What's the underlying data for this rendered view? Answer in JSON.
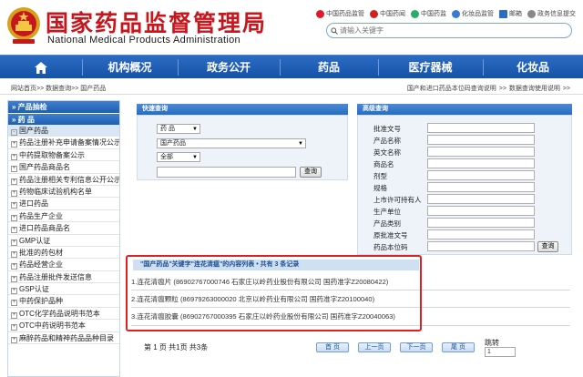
{
  "header": {
    "title": "国家药品监督管理局",
    "subtitle": "National Medical Products Administration",
    "top_links": [
      {
        "label": "中国药品监管",
        "icon": "weibo-icon",
        "color": "#e6162d"
      },
      {
        "label": "中国药闻",
        "icon": "news-icon",
        "color": "#d02020"
      },
      {
        "label": "中国药监",
        "icon": "wechat-icon",
        "color": "#2aae67"
      },
      {
        "label": "化妆品监管",
        "icon": "cosmetics-icon",
        "color": "#3a7bd5"
      },
      {
        "label": "邮箱",
        "icon": "mail-icon",
        "color": "#2b6cc4"
      },
      {
        "label": "政务信息提交",
        "icon": "submit-icon",
        "color": "#888888"
      }
    ],
    "search_placeholder": "请输入关键字"
  },
  "nav": {
    "items": [
      "机构概况",
      "政务公开",
      "药品",
      "医疗器械",
      "化妆品"
    ],
    "home_icon": "home-icon"
  },
  "breadcrumb": {
    "path": "网站首页>> 数据查询>> 国产药品",
    "right_links": "国产和进口药品本位码查询说明 >>    数据查询使用说明 >>"
  },
  "sidebar": {
    "section1": "» 产品抽检",
    "section2": "» 药    品",
    "items": [
      "国产药品",
      "药品注册补充申请备案情况公示",
      "中药提取物备案公示",
      "国产药品商品名",
      "药品注册相关专利信息公开公示",
      "药物临床试验机构名单",
      "进口药品",
      "药品生产企业",
      "进口药品商品名",
      "GMP认证",
      "批准的药包材",
      "药品经营企业",
      "药品注册批件发送信息",
      "GSP认证",
      "中药保护品种",
      "OTC化学药品说明书范本",
      "OTC中药说明书范本",
      "麻醉药品和精神药品品种目录"
    ]
  },
  "quick_search": {
    "title": "快速查询",
    "category": "药    品",
    "subcategory": "国产药品",
    "scope": "全部",
    "button": "查询"
  },
  "advanced_search": {
    "title": "高级查询",
    "fields": [
      "批准文号",
      "产品名称",
      "英文名称",
      "商品名",
      "剂型",
      "规格",
      "上市许可持有人",
      "生产单位",
      "产品类别",
      "原批准文号",
      "药品本位码"
    ],
    "button": "查询"
  },
  "results": {
    "header": "\"国产药品\"关键字\"连花清瘟\"的内容列表 • 共有 3 条记录",
    "rows": [
      "1.连花清瘟片 (86902767000746 石家庄以岭药业股份有限公司 国药准字Z20080422)",
      "2.连花清瘟颗粒 (86979263000020 北京以岭药业有限公司 国药准字Z20100040)",
      "3.连花清瘟胶囊 (86902767000395 石家庄以岭药业股份有限公司 国药准字Z20040063)"
    ]
  },
  "pager": {
    "info": "第 1 页 共1页 共3条",
    "first": "首 页",
    "prev": "上一页",
    "next": "下一页",
    "last": "尾 页",
    "jump_label": "跳转",
    "jump_value": "1"
  },
  "colors": {
    "brand_red": "#c8161d",
    "nav_blue": "#1a5db0",
    "highlight_red": "#e02020"
  }
}
